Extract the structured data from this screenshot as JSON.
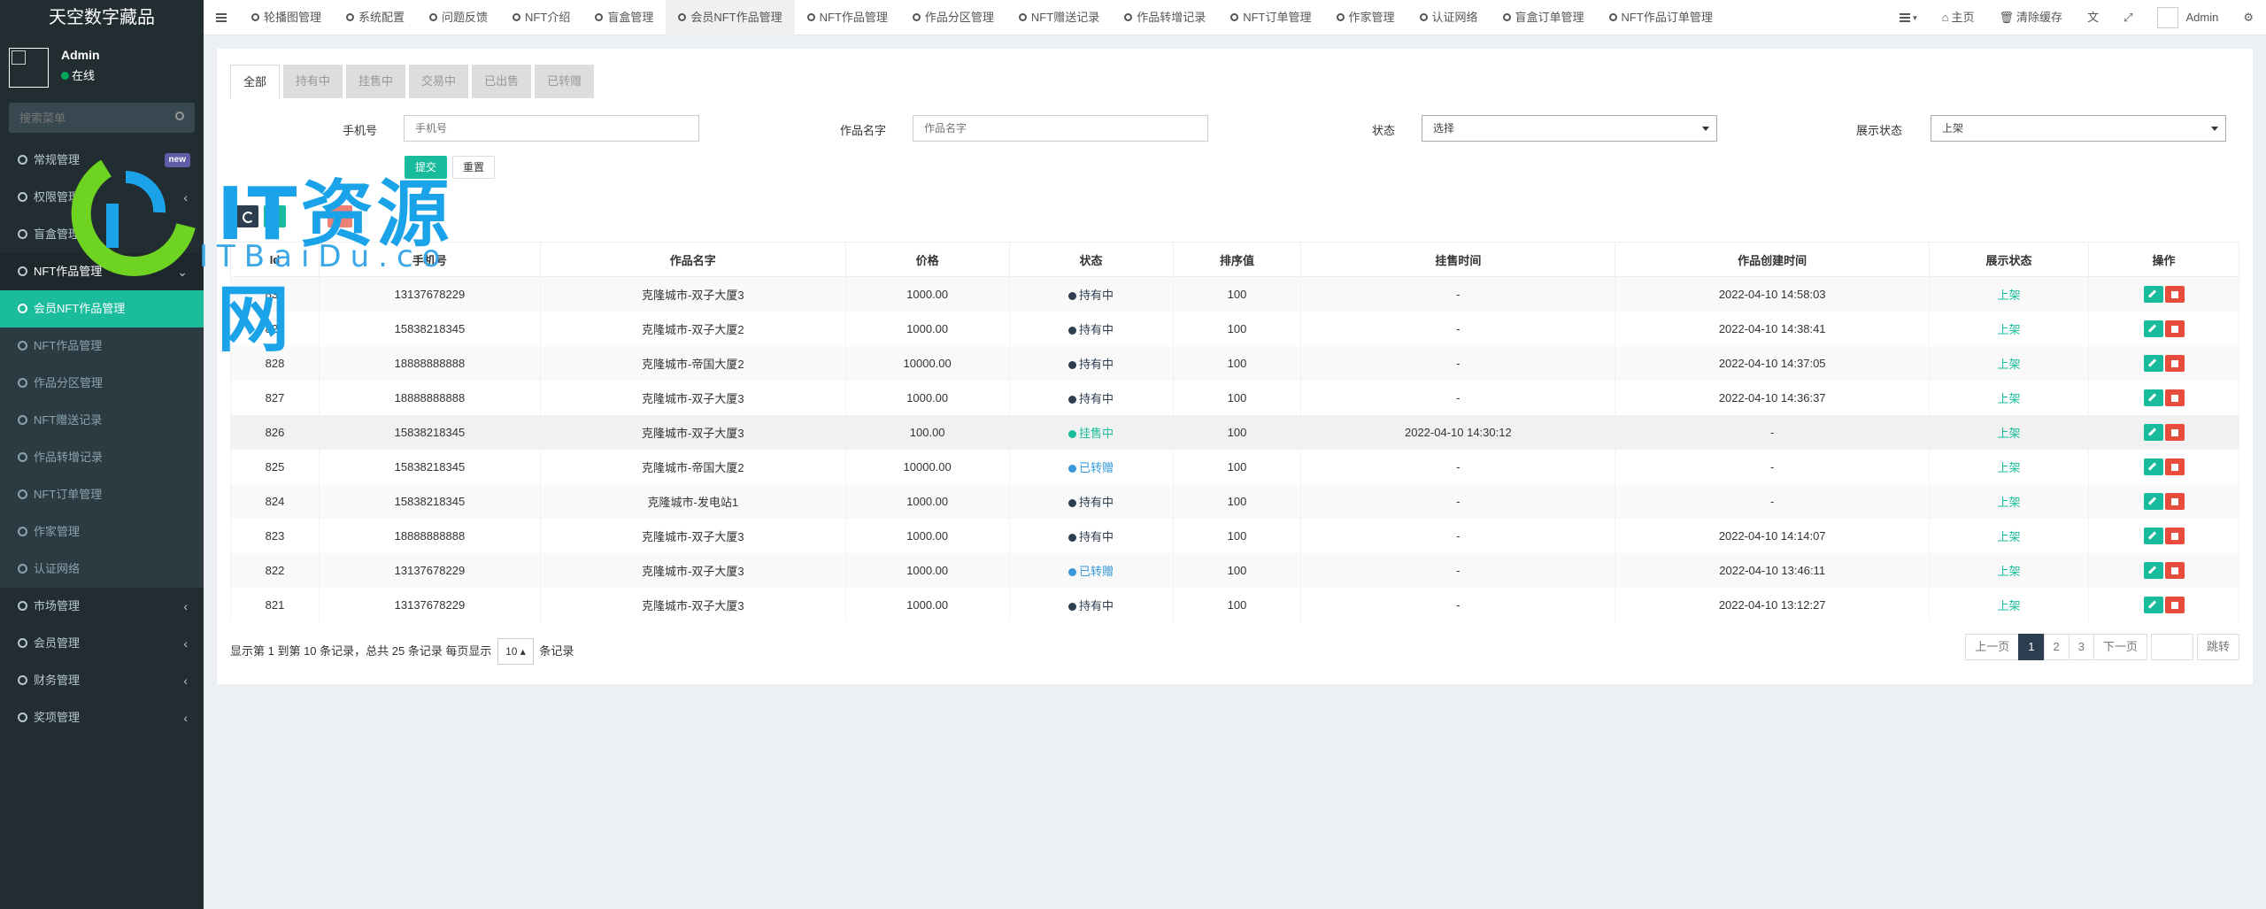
{
  "sidebar": {
    "logo": "天空数字藏品",
    "user": {
      "name": "Admin",
      "status": "在线"
    },
    "search_placeholder": "搜索菜单",
    "items": [
      {
        "label": "常规管理",
        "badge": "new"
      },
      {
        "label": "权限管理"
      },
      {
        "label": "盲盒管理"
      },
      {
        "label": "NFT作品管理"
      },
      {
        "label": "会员NFT作品管理"
      },
      {
        "label": "NFT作品管理"
      },
      {
        "label": "作品分区管理"
      },
      {
        "label": "NFT赠送记录"
      },
      {
        "label": "作品转增记录"
      },
      {
        "label": "NFT订单管理"
      },
      {
        "label": "作家管理"
      },
      {
        "label": "认证网络"
      },
      {
        "label": "市场管理"
      },
      {
        "label": "会员管理"
      },
      {
        "label": "财务管理"
      },
      {
        "label": "奖项管理"
      }
    ]
  },
  "topnav": {
    "tabs": [
      "轮播图管理",
      "系统配置",
      "问题反馈",
      "NFT介绍",
      "盲盒管理",
      "会员NFT作品管理",
      "NFT作品管理",
      "作品分区管理",
      "NFT赠送记录",
      "作品转增记录",
      "NFT订单管理",
      "作家管理",
      "认证网络",
      "盲盒订单管理",
      "NFT作品订单管理"
    ],
    "home": "主页",
    "clear_cache": "清除缓存",
    "admin": "Admin"
  },
  "filter_tabs": [
    "全部",
    "持有中",
    "挂售中",
    "交易中",
    "已出售",
    "已转赠"
  ],
  "filters": {
    "phone": {
      "label": "手机号",
      "placeholder": "手机号"
    },
    "work_name": {
      "label": "作品名字",
      "placeholder": "作品名字"
    },
    "status": {
      "label": "状态",
      "value": "选择"
    },
    "show_status": {
      "label": "展示状态",
      "value": "上架"
    },
    "submit": "提交",
    "reset": "重置"
  },
  "table": {
    "columns": [
      "Id",
      "手机号",
      "作品名字",
      "价格",
      "状态",
      "排序值",
      "挂售时间",
      "作品创建时间",
      "展示状态",
      "操作"
    ],
    "rows": [
      {
        "id": "830",
        "phone": "13137678229",
        "name": "克隆城市-双子大厦3",
        "price": "1000.00",
        "status": "持有中",
        "status_type": "hold",
        "sort": "100",
        "sale_time": "-",
        "created": "2022-04-10 14:58:03",
        "show": "上架"
      },
      {
        "id": "829",
        "phone": "15838218345",
        "name": "克隆城市-双子大厦2",
        "price": "1000.00",
        "status": "持有中",
        "status_type": "hold",
        "sort": "100",
        "sale_time": "-",
        "created": "2022-04-10 14:38:41",
        "show": "上架"
      },
      {
        "id": "828",
        "phone": "18888888888",
        "name": "克隆城市-帝国大厦2",
        "price": "10000.00",
        "status": "持有中",
        "status_type": "hold",
        "sort": "100",
        "sale_time": "-",
        "created": "2022-04-10 14:37:05",
        "show": "上架"
      },
      {
        "id": "827",
        "phone": "18888888888",
        "name": "克隆城市-双子大厦3",
        "price": "1000.00",
        "status": "持有中",
        "status_type": "hold",
        "sort": "100",
        "sale_time": "-",
        "created": "2022-04-10 14:36:37",
        "show": "上架"
      },
      {
        "id": "826",
        "phone": "15838218345",
        "name": "克隆城市-双子大厦3",
        "price": "100.00",
        "status": "挂售中",
        "status_type": "sell",
        "sort": "100",
        "sale_time": "2022-04-10 14:30:12",
        "created": "-",
        "show": "上架"
      },
      {
        "id": "825",
        "phone": "15838218345",
        "name": "克隆城市-帝国大厦2",
        "price": "10000.00",
        "status": "已转赠",
        "status_type": "transfer",
        "sort": "100",
        "sale_time": "-",
        "created": "-",
        "show": "上架"
      },
      {
        "id": "824",
        "phone": "15838218345",
        "name": "克隆城市-发电站1",
        "price": "1000.00",
        "status": "持有中",
        "status_type": "hold",
        "sort": "100",
        "sale_time": "-",
        "created": "-",
        "show": "上架"
      },
      {
        "id": "823",
        "phone": "18888888888",
        "name": "克隆城市-双子大厦3",
        "price": "1000.00",
        "status": "持有中",
        "status_type": "hold",
        "sort": "100",
        "sale_time": "-",
        "created": "2022-04-10 14:14:07",
        "show": "上架"
      },
      {
        "id": "822",
        "phone": "13137678229",
        "name": "克隆城市-双子大厦3",
        "price": "1000.00",
        "status": "已转赠",
        "status_type": "transfer",
        "sort": "100",
        "sale_time": "-",
        "created": "2022-04-10 13:46:11",
        "show": "上架"
      },
      {
        "id": "821",
        "phone": "13137678229",
        "name": "克隆城市-双子大厦3",
        "price": "1000.00",
        "status": "持有中",
        "status_type": "hold",
        "sort": "100",
        "sale_time": "-",
        "created": "2022-04-10 13:12:27",
        "show": "上架"
      }
    ]
  },
  "pagination": {
    "info_prefix": "显示第 1 到第 10 条记录，总共 25 条记录 每页显示",
    "page_size": "10",
    "info_suffix": "条记录",
    "prev": "上一页",
    "pages": [
      "1",
      "2",
      "3"
    ],
    "next": "下一页",
    "jump": "跳转"
  },
  "watermark": {
    "text": "IT资源网",
    "sub": "ITBaiDu.co"
  }
}
